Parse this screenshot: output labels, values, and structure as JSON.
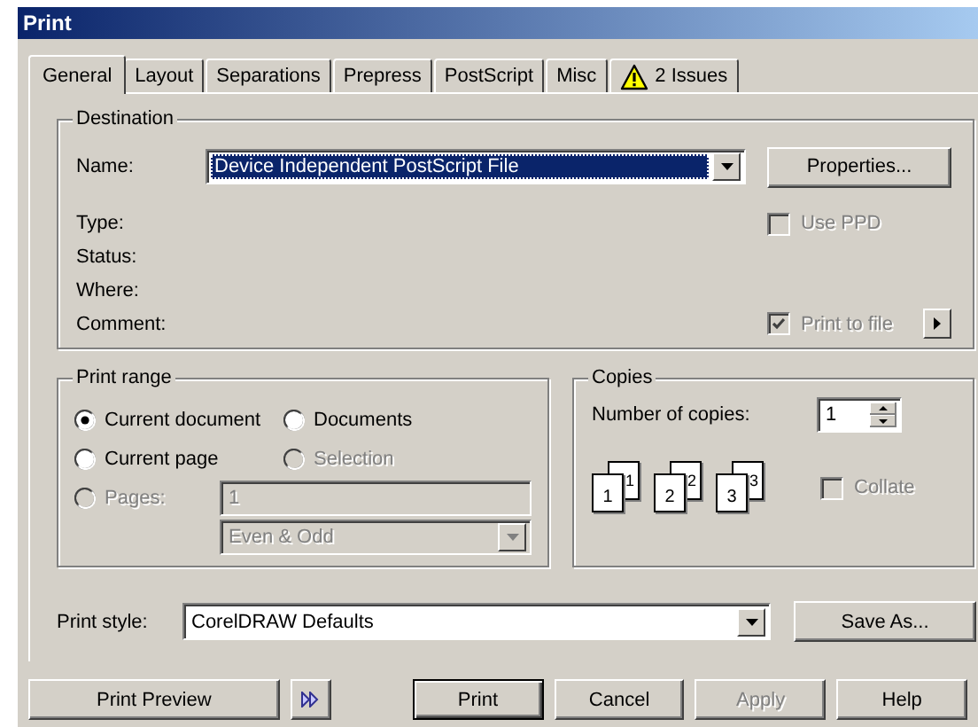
{
  "window": {
    "title": "Print"
  },
  "tabs": [
    {
      "label": "General",
      "selected": true,
      "kind": "plain"
    },
    {
      "label": "Layout",
      "selected": false,
      "kind": "plain"
    },
    {
      "label": "Separations",
      "selected": false,
      "kind": "plain"
    },
    {
      "label": "Prepress",
      "selected": false,
      "kind": "plain"
    },
    {
      "label": "PostScript",
      "selected": false,
      "kind": "plain"
    },
    {
      "label": "Misc",
      "selected": false,
      "kind": "plain"
    },
    {
      "label": "2 Issues",
      "selected": false,
      "kind": "warning"
    }
  ],
  "destination": {
    "title": "Destination",
    "name_label": "Name:",
    "printer": "Device Independent PostScript File",
    "focused": true,
    "properties_button": "Properties...",
    "info_labels": [
      "Type:",
      "Status:",
      "Where:",
      "Comment:"
    ],
    "use_ppd": {
      "label": "Use PPD",
      "checked": false,
      "disabled": true
    },
    "print_to_file": {
      "label": "Print to file",
      "checked": true,
      "disabled": true
    }
  },
  "print_range": {
    "title": "Print range",
    "options": [
      {
        "label": "Current document",
        "selected": true,
        "disabled": false
      },
      {
        "label": "Documents",
        "selected": false,
        "disabled": false
      },
      {
        "label": "Current page",
        "selected": false,
        "disabled": false
      },
      {
        "label": "Selection",
        "selected": false,
        "disabled": true
      },
      {
        "label": "Pages:",
        "selected": false,
        "disabled": true
      }
    ],
    "pages_value": "1",
    "page_filter": "Even & Odd",
    "disabled": true
  },
  "copies": {
    "title": "Copies",
    "label": "Number of copies:",
    "value": "1",
    "page_numbers": [
      "1",
      "1",
      "2",
      "2",
      "3",
      "3"
    ],
    "collate": {
      "label": "Collate",
      "checked": false,
      "disabled": true
    }
  },
  "print_style": {
    "label": "Print style:",
    "value": "CorelDRAW Defaults",
    "save_button": "Save As..."
  },
  "preview_button": "Print Preview",
  "buttons": [
    {
      "label": "Print",
      "default": true,
      "disabled": false
    },
    {
      "label": "Cancel",
      "default": false,
      "disabled": false
    },
    {
      "label": "Apply",
      "default": false,
      "disabled": true
    },
    {
      "label": "Help",
      "default": false,
      "disabled": false
    }
  ]
}
